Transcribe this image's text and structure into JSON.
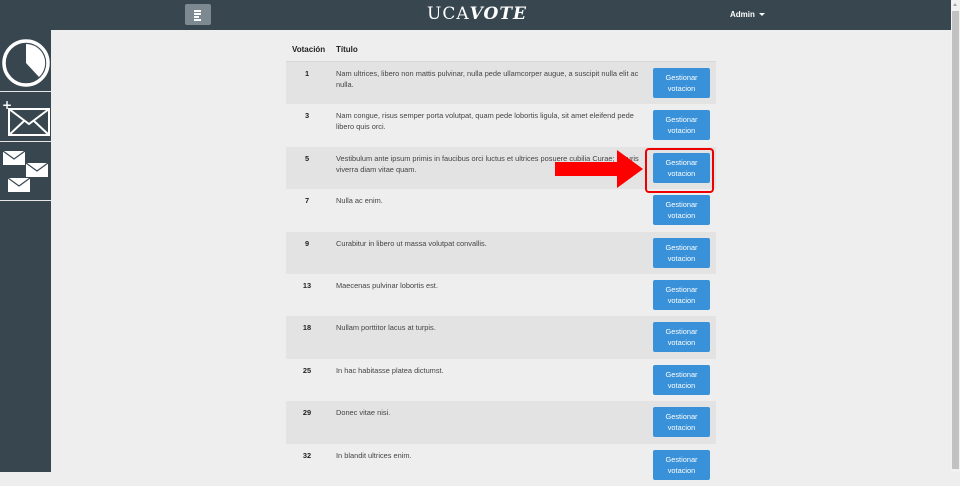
{
  "header": {
    "brand_prefix": "UCA",
    "brand_suffix": "VOTE",
    "user_menu_label": "Admin"
  },
  "sidebar": {
    "items": [
      {
        "icon": "clock-icon"
      },
      {
        "icon": "new-mail-icon"
      },
      {
        "icon": "multiple-mail-icon"
      }
    ]
  },
  "table": {
    "headers": {
      "votacion": "Votación",
      "titulo": "Título"
    },
    "button_label_line1": "Gestionar",
    "button_label_line2": "votacion",
    "rows": [
      {
        "id": "1",
        "title": "Nam ultrices, libero non mattis pulvinar, nulla pede ullamcorper augue, a suscipit nulla elit ac nulla."
      },
      {
        "id": "3",
        "title": "Nam congue, risus semper porta volutpat, quam pede lobortis ligula, sit amet eleifend pede libero quis orci."
      },
      {
        "id": "5",
        "title": "Vestibulum ante ipsum primis in faucibus orci luctus et ultrices posuere cubilia Curae; Mauris viverra diam vitae quam."
      },
      {
        "id": "7",
        "title": "Nulla ac enim."
      },
      {
        "id": "9",
        "title": "Curabitur in libero ut massa volutpat convallis."
      },
      {
        "id": "13",
        "title": "Maecenas pulvinar lobortis est."
      },
      {
        "id": "18",
        "title": "Nullam porttitor lacus at turpis."
      },
      {
        "id": "25",
        "title": "In hac habitasse platea dictumst."
      },
      {
        "id": "29",
        "title": "Donec vitae nisi."
      },
      {
        "id": "32",
        "title": "In blandit ultrices enim."
      }
    ]
  },
  "annotation": {
    "highlighted_row": "5",
    "color": "#e00000"
  },
  "colors": {
    "topbar": "#38474f",
    "button": "#3891d9"
  }
}
